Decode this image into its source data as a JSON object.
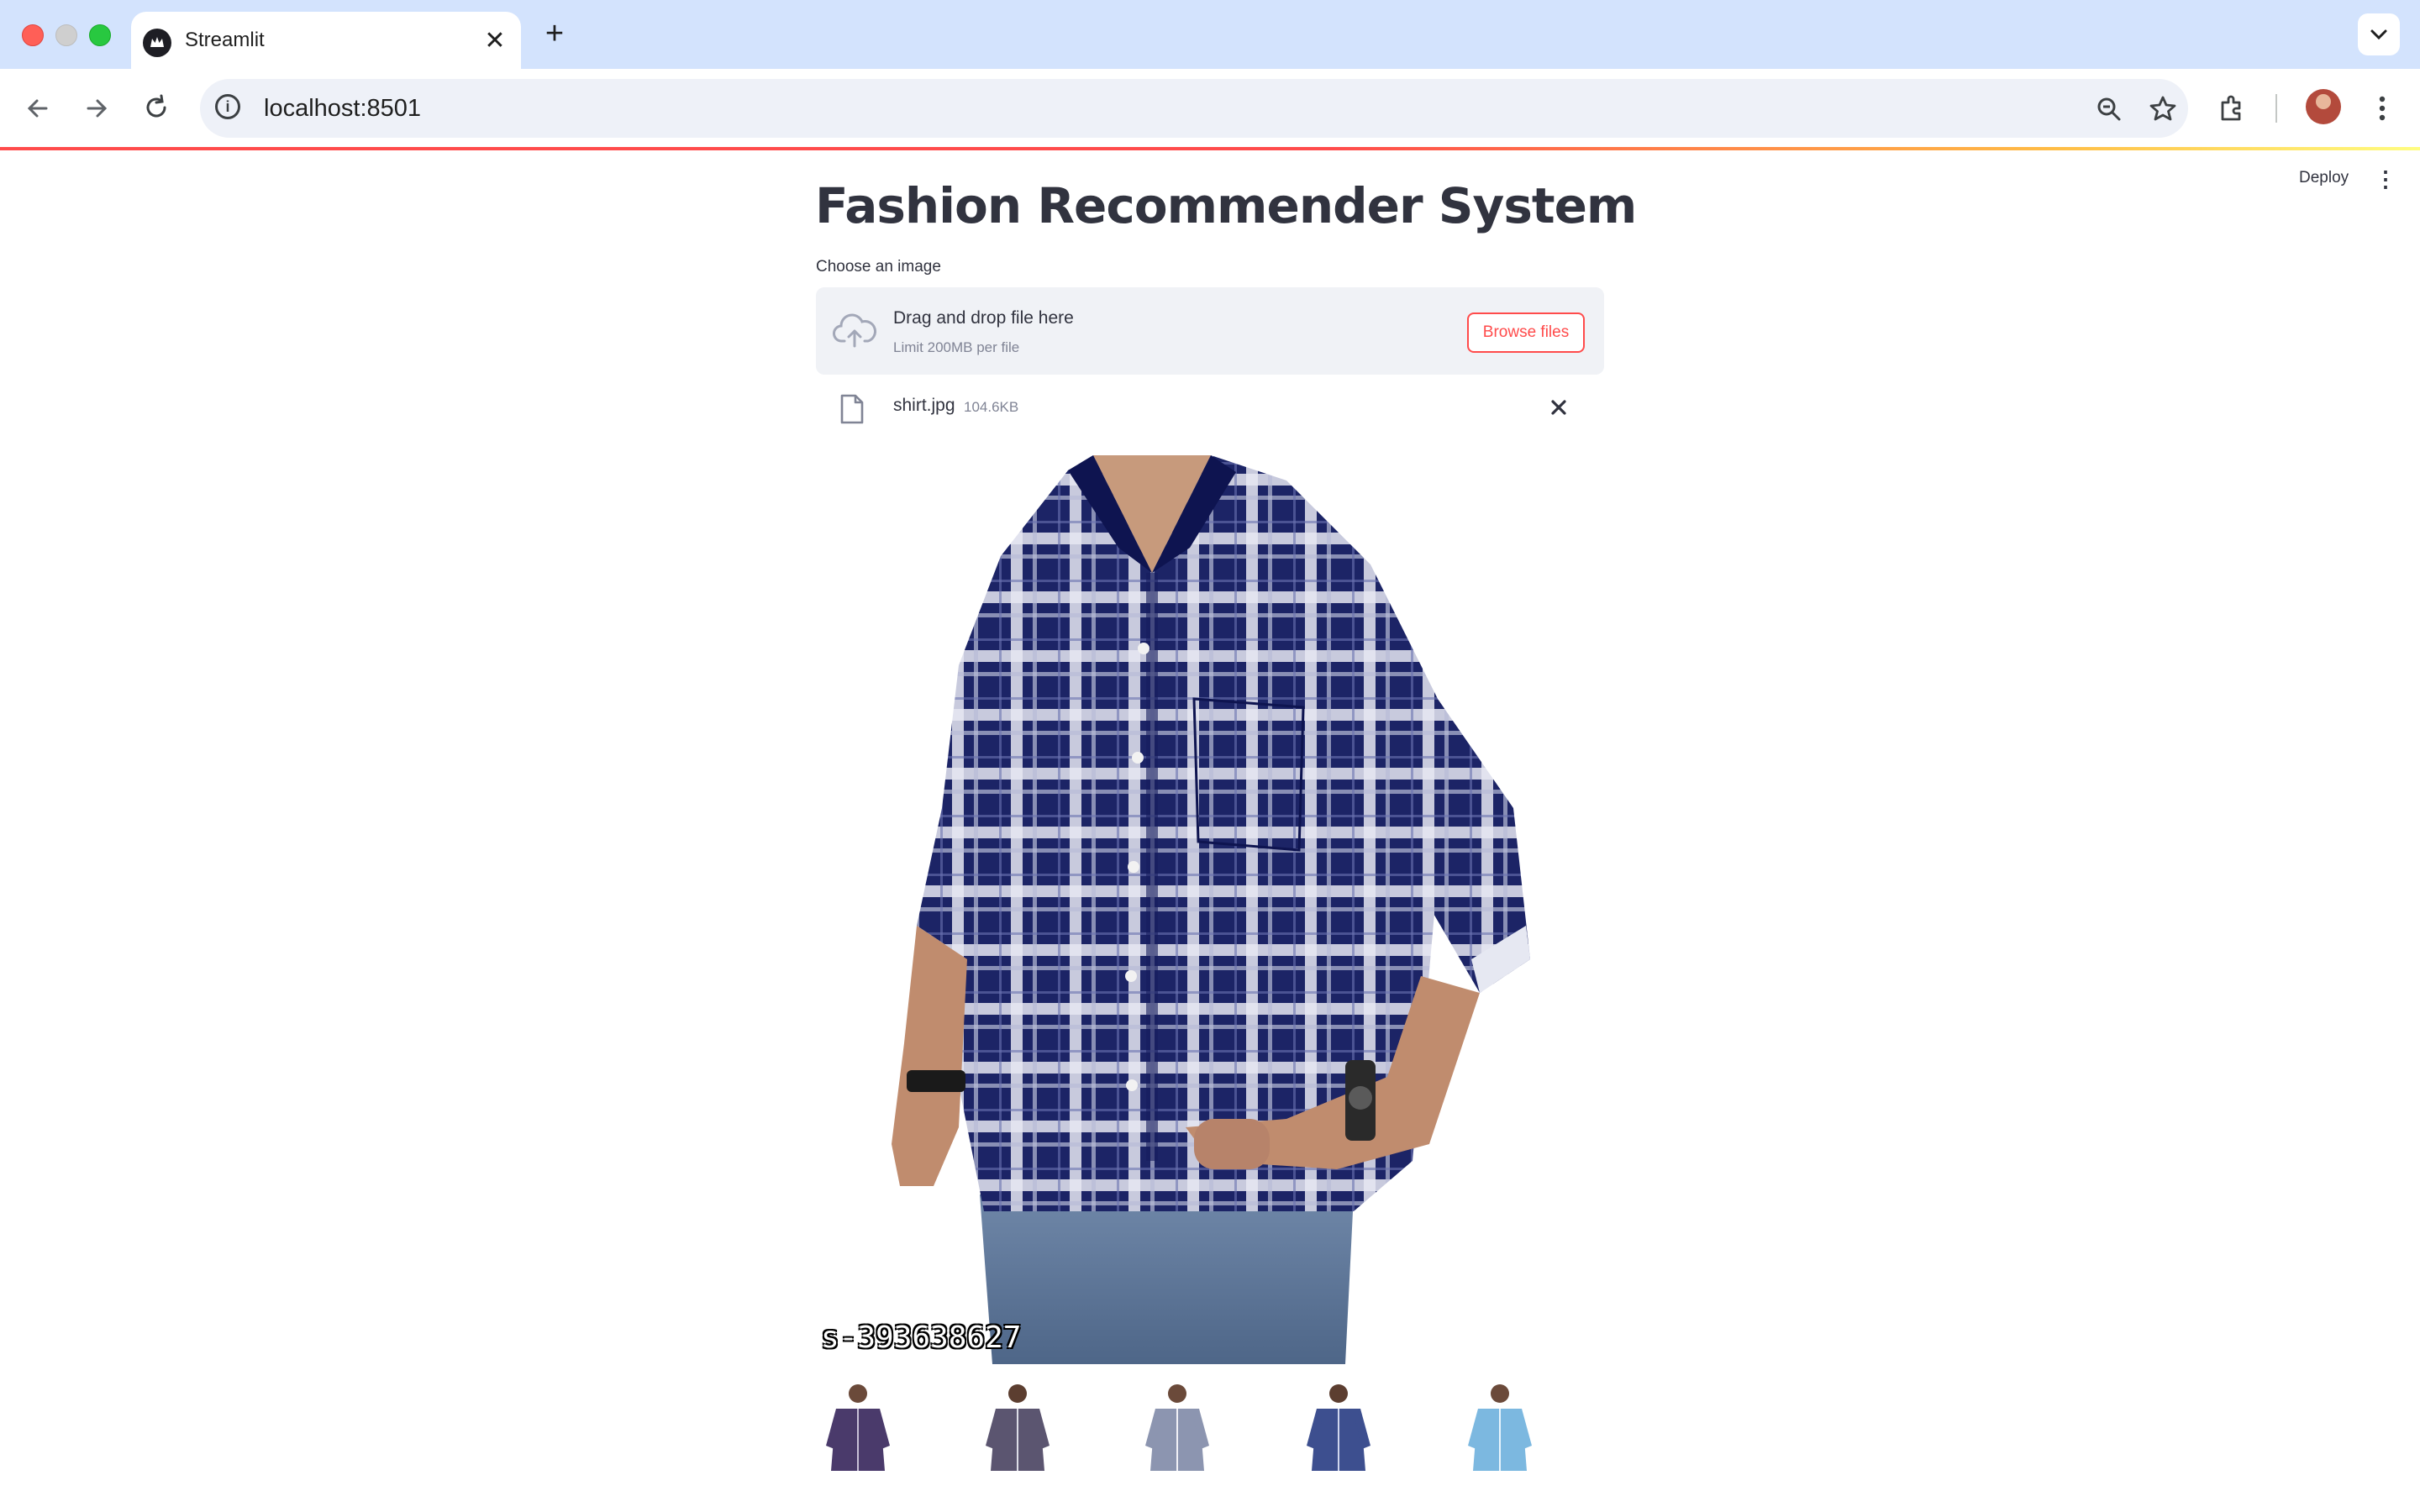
{
  "browser": {
    "tab_title": "Streamlit",
    "tab_close": "✕",
    "new_tab": "+",
    "url": "localhost:8501"
  },
  "app": {
    "deploy_label": "Deploy",
    "title": "Fashion Recommender System",
    "uploader": {
      "label": "Choose an image",
      "drop_text": "Drag and drop file here",
      "limit_text": "Limit 200MB per file",
      "browse_label": "Browse files"
    },
    "uploaded_file": {
      "name": "shirt.jpg",
      "size": "104.6KB"
    },
    "image_caption": "s-393638627",
    "recommendations": [
      {
        "name": "rec-1",
        "color": "#4a3a6b"
      },
      {
        "name": "rec-2",
        "color": "#5b5570"
      },
      {
        "name": "rec-3",
        "color": "#8c95b0"
      },
      {
        "name": "rec-4",
        "color": "#3d4f8f"
      },
      {
        "name": "rec-5",
        "color": "#7cb8e0"
      }
    ]
  },
  "colors": {
    "accent": "#ff4b4b",
    "text": "#31333f",
    "dropzone_bg": "#f0f2f6",
    "chrome_tabbar": "#d3e3fd"
  }
}
